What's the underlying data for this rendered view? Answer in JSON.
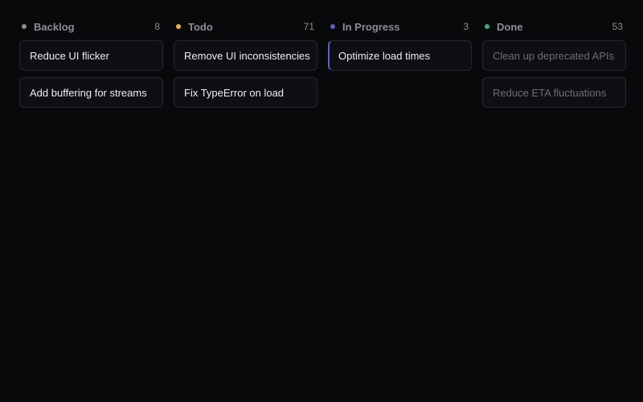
{
  "colors": {
    "backlog": "#8e8f95",
    "todo": "#f0b33a",
    "in_progress": "#5a62c9",
    "done": "#2fb47c"
  },
  "columns": [
    {
      "title": "Backlog",
      "count": "8",
      "cards": [
        "Reduce UI flicker",
        "Add buffering for streams"
      ]
    },
    {
      "title": "Todo",
      "count": "71",
      "cards": [
        "Remove UI inconsistencies",
        "Fix TypeError on load"
      ]
    },
    {
      "title": "In Progress",
      "count": "3",
      "cards": [
        "Optimize load times"
      ]
    },
    {
      "title": "Done",
      "count": "53",
      "cards": [
        "Clean up deprecated APIs",
        "Reduce ETA fluctuations"
      ]
    }
  ]
}
